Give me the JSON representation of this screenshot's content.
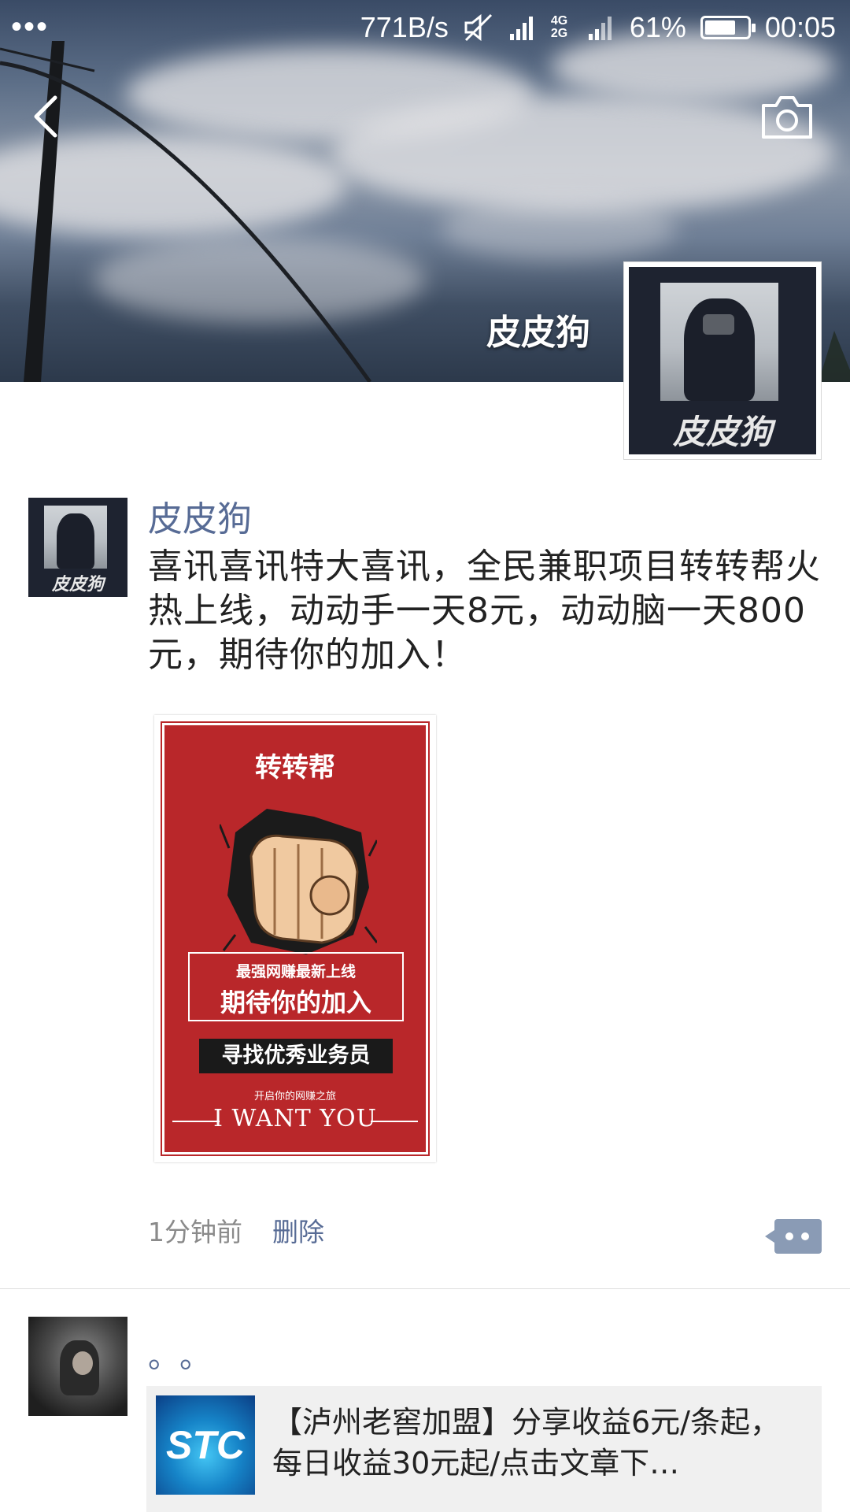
{
  "status_bar": {
    "network_speed": "771B/s",
    "network_labels": "4G 2G",
    "battery": "61%",
    "time": "00:05"
  },
  "header": {
    "back_icon": "back-chevron-icon",
    "camera_icon": "camera-icon",
    "profile_name": "皮皮狗",
    "avatar_caption": "皮皮狗"
  },
  "posts": [
    {
      "author": "皮皮狗",
      "avatar_caption": "皮皮狗",
      "text": "喜讯喜讯特大喜讯，全民兼职项目转转帮火热上线，动动手一天8元，动动脑一天800元，期待你的加入！",
      "poster": {
        "title": "转转帮",
        "box_line1": "最强网赚最新上线",
        "box_line2": "期待你的加入",
        "banner": "寻找优秀业务员",
        "sub": "开启你的网赚之旅",
        "slogan": "I WANT YOU"
      },
      "time": "1分钟前",
      "delete_label": "删除"
    },
    {
      "text": "。。",
      "link": {
        "thumb_text": "STC",
        "title": "【泸州老窖加盟】分享收益6元/条起，每日收益30元起/点击文章下…"
      }
    }
  ],
  "colors": {
    "link_blue": "#576b95",
    "poster_red": "#b9272a",
    "more_button": "#8a9bb5"
  }
}
